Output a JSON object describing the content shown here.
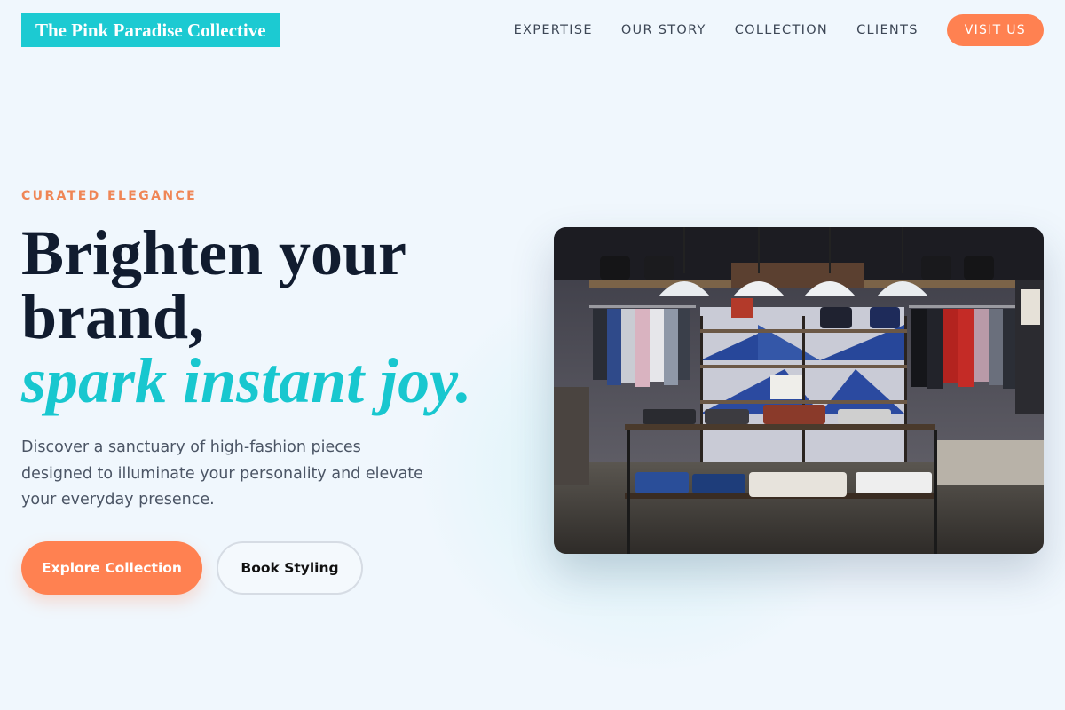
{
  "header": {
    "logo_text": "The Pink Paradise Collective",
    "nav": [
      "EXPERTISE",
      "OUR STORY",
      "COLLECTION",
      "CLIENTS"
    ],
    "cta_label": "VISIT US"
  },
  "hero": {
    "eyebrow": "CURATED ELEGANCE",
    "headline_line1": "Brighten your",
    "headline_line2": "brand,",
    "headline_accent": "spark instant joy.",
    "lead": "Discover a sanctuary of high-fashion pieces designed to illuminate your personality and elevate your everyday presence.",
    "primary_cta": "Explore Collection",
    "secondary_cta": "Book Styling",
    "image_alt": "Boutique interior with clothing racks and pendant lights"
  },
  "colors": {
    "background": "#f0f7fd",
    "logo_bg": "#1ccad2",
    "accent_orange": "#ff8151",
    "accent_teal": "#18c7cf",
    "heading": "#111c2f"
  }
}
